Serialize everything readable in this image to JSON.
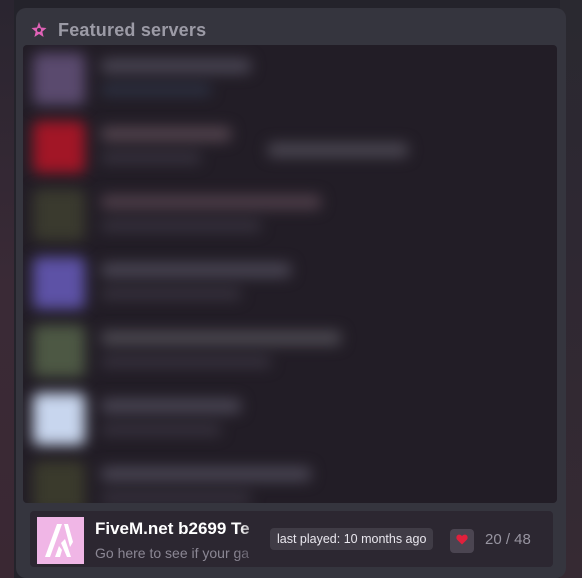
{
  "panel": {
    "title": "Featured servers",
    "icon": "star-icon",
    "accent": "#e062b7"
  },
  "blurred_rows": [
    {
      "thumb": "#5a4a6e"
    },
    {
      "thumb": "#a21626"
    },
    {
      "thumb": "#3a3a2e"
    },
    {
      "thumb": "#5d52a6"
    },
    {
      "thumb": "#4d5844"
    },
    {
      "thumb": "#c8d6ee"
    },
    {
      "thumb": "#3a3a2c"
    }
  ],
  "featured_server": {
    "icon": "fivem-logo-icon",
    "icon_bg": "#f0b6e6",
    "name": "FiveM.net b2699 Te",
    "description": "Go here to see if your ga",
    "last_played": "last played: 10 months ago",
    "favorite_icon": "heart-icon",
    "players": "20 / 48"
  }
}
